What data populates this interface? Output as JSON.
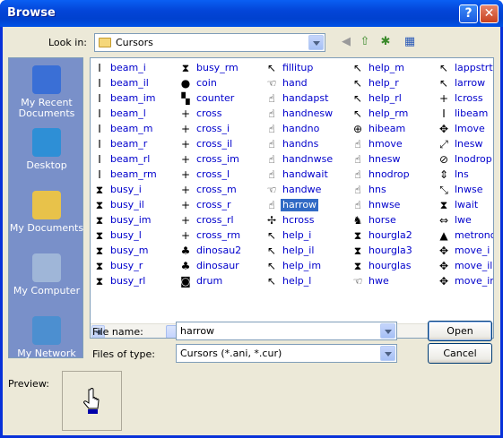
{
  "window": {
    "title": "Browse",
    "help_glyph": "?",
    "close_glyph": "✕"
  },
  "look_in": {
    "label": "Look in:",
    "label_hotkey": "i",
    "value": "Cursors"
  },
  "toolbar": [
    {
      "name": "back-icon",
      "glyph": "◀"
    },
    {
      "name": "up-folder-icon",
      "glyph": "⇧"
    },
    {
      "name": "new-folder-icon",
      "glyph": "✱"
    },
    {
      "name": "views-menu-icon",
      "glyph": "▦"
    }
  ],
  "places": [
    {
      "name": "my-recent-documents",
      "icon": "recent-docs-icon",
      "label": "My Recent Documents",
      "color": "#3a6fd6"
    },
    {
      "name": "desktop",
      "icon": "desktop-icon",
      "label": "Desktop",
      "color": "#2e8fd6"
    },
    {
      "name": "my-documents",
      "icon": "my-documents-icon",
      "label": "My Documents",
      "color": "#e8c24a"
    },
    {
      "name": "my-computer",
      "icon": "my-computer-icon",
      "label": "My Computer",
      "color": "#9fb6d8"
    },
    {
      "name": "my-network",
      "icon": "my-network-icon",
      "label": "My Network",
      "color": "#4c8fd0"
    }
  ],
  "files": [
    [
      {
        "n": "beam_i",
        "g": "I"
      },
      {
        "n": "beam_il",
        "g": "I"
      },
      {
        "n": "beam_im",
        "g": "I"
      },
      {
        "n": "beam_l",
        "g": "I"
      },
      {
        "n": "beam_m",
        "g": "I"
      },
      {
        "n": "beam_r",
        "g": "I"
      },
      {
        "n": "beam_rl",
        "g": "I"
      },
      {
        "n": "beam_rm",
        "g": "I"
      },
      {
        "n": "busy_i",
        "g": "⧗"
      },
      {
        "n": "busy_il",
        "g": "⧗"
      },
      {
        "n": "busy_im",
        "g": "⧗"
      },
      {
        "n": "busy_l",
        "g": "⧗"
      },
      {
        "n": "busy_m",
        "g": "⧗"
      },
      {
        "n": "busy_r",
        "g": "⧗"
      },
      {
        "n": "busy_rl",
        "g": "⧗"
      }
    ],
    [
      {
        "n": "busy_rm",
        "g": "⧗"
      },
      {
        "n": "coin",
        "g": "●"
      },
      {
        "n": "counter",
        "g": "▚"
      },
      {
        "n": "cross",
        "g": "+"
      },
      {
        "n": "cross_i",
        "g": "+"
      },
      {
        "n": "cross_il",
        "g": "+"
      },
      {
        "n": "cross_im",
        "g": "+"
      },
      {
        "n": "cross_l",
        "g": "+"
      },
      {
        "n": "cross_m",
        "g": "+"
      },
      {
        "n": "cross_r",
        "g": "+"
      },
      {
        "n": "cross_rl",
        "g": "+"
      },
      {
        "n": "cross_rm",
        "g": "+"
      },
      {
        "n": "dinosau2",
        "g": "♣"
      },
      {
        "n": "dinosaur",
        "g": "♣"
      },
      {
        "n": "drum",
        "g": "◙"
      }
    ],
    [
      {
        "n": "fillitup",
        "g": "↖"
      },
      {
        "n": "hand",
        "g": "☜"
      },
      {
        "n": "handapst",
        "g": "☝"
      },
      {
        "n": "handnesw",
        "g": "☝"
      },
      {
        "n": "handno",
        "g": "☝"
      },
      {
        "n": "handns",
        "g": "☝"
      },
      {
        "n": "handnwse",
        "g": "☝"
      },
      {
        "n": "handwait",
        "g": "☝"
      },
      {
        "n": "handwe",
        "g": "☜"
      },
      {
        "n": "harrow",
        "g": "☝",
        "sel": true
      },
      {
        "n": "hcross",
        "g": "✢"
      },
      {
        "n": "help_i",
        "g": "↖"
      },
      {
        "n": "help_il",
        "g": "↖"
      },
      {
        "n": "help_im",
        "g": "↖"
      },
      {
        "n": "help_l",
        "g": "↖"
      }
    ],
    [
      {
        "n": "help_m",
        "g": "↖"
      },
      {
        "n": "help_r",
        "g": "↖"
      },
      {
        "n": "help_rl",
        "g": "↖"
      },
      {
        "n": "help_rm",
        "g": "↖"
      },
      {
        "n": "hibeam",
        "g": "⊕"
      },
      {
        "n": "hmove",
        "g": "☝"
      },
      {
        "n": "hnesw",
        "g": "☝"
      },
      {
        "n": "hnodrop",
        "g": "☝"
      },
      {
        "n": "hns",
        "g": "☝"
      },
      {
        "n": "hnwse",
        "g": "☝"
      },
      {
        "n": "horse",
        "g": "♞"
      },
      {
        "n": "hourgla2",
        "g": "⧗"
      },
      {
        "n": "hourgla3",
        "g": "⧗"
      },
      {
        "n": "hourglas",
        "g": "⧗"
      },
      {
        "n": "hwe",
        "g": "☜"
      }
    ],
    [
      {
        "n": "lappstrt",
        "g": "↖"
      },
      {
        "n": "larrow",
        "g": "↖"
      },
      {
        "n": "lcross",
        "g": "+"
      },
      {
        "n": "libeam",
        "g": "I"
      },
      {
        "n": "lmove",
        "g": "✥"
      },
      {
        "n": "lnesw",
        "g": "⤢"
      },
      {
        "n": "lnodrop",
        "g": "⊘"
      },
      {
        "n": "lns",
        "g": "⇕"
      },
      {
        "n": "lnwse",
        "g": "⤡"
      },
      {
        "n": "lwait",
        "g": "⧗"
      },
      {
        "n": "lwe",
        "g": "⇔"
      },
      {
        "n": "metronom",
        "g": "▲"
      },
      {
        "n": "move_i",
        "g": "✥"
      },
      {
        "n": "move_il",
        "g": "✥"
      },
      {
        "n": "move_im",
        "g": "✥"
      }
    ]
  ],
  "file_name": {
    "label": "File name:",
    "label_hotkey": "n",
    "value": "harrow"
  },
  "file_type": {
    "label": "Files of type:",
    "label_hotkey": "t",
    "value": "Cursors (*.ani, *.cur)"
  },
  "buttons": {
    "open": "Open",
    "open_hotkey": "O",
    "cancel": "Cancel"
  },
  "preview": {
    "label": "Preview:"
  },
  "colors": {
    "accent": "#316ac5",
    "link": "#0000cc",
    "titlebar": "#0545d8"
  }
}
